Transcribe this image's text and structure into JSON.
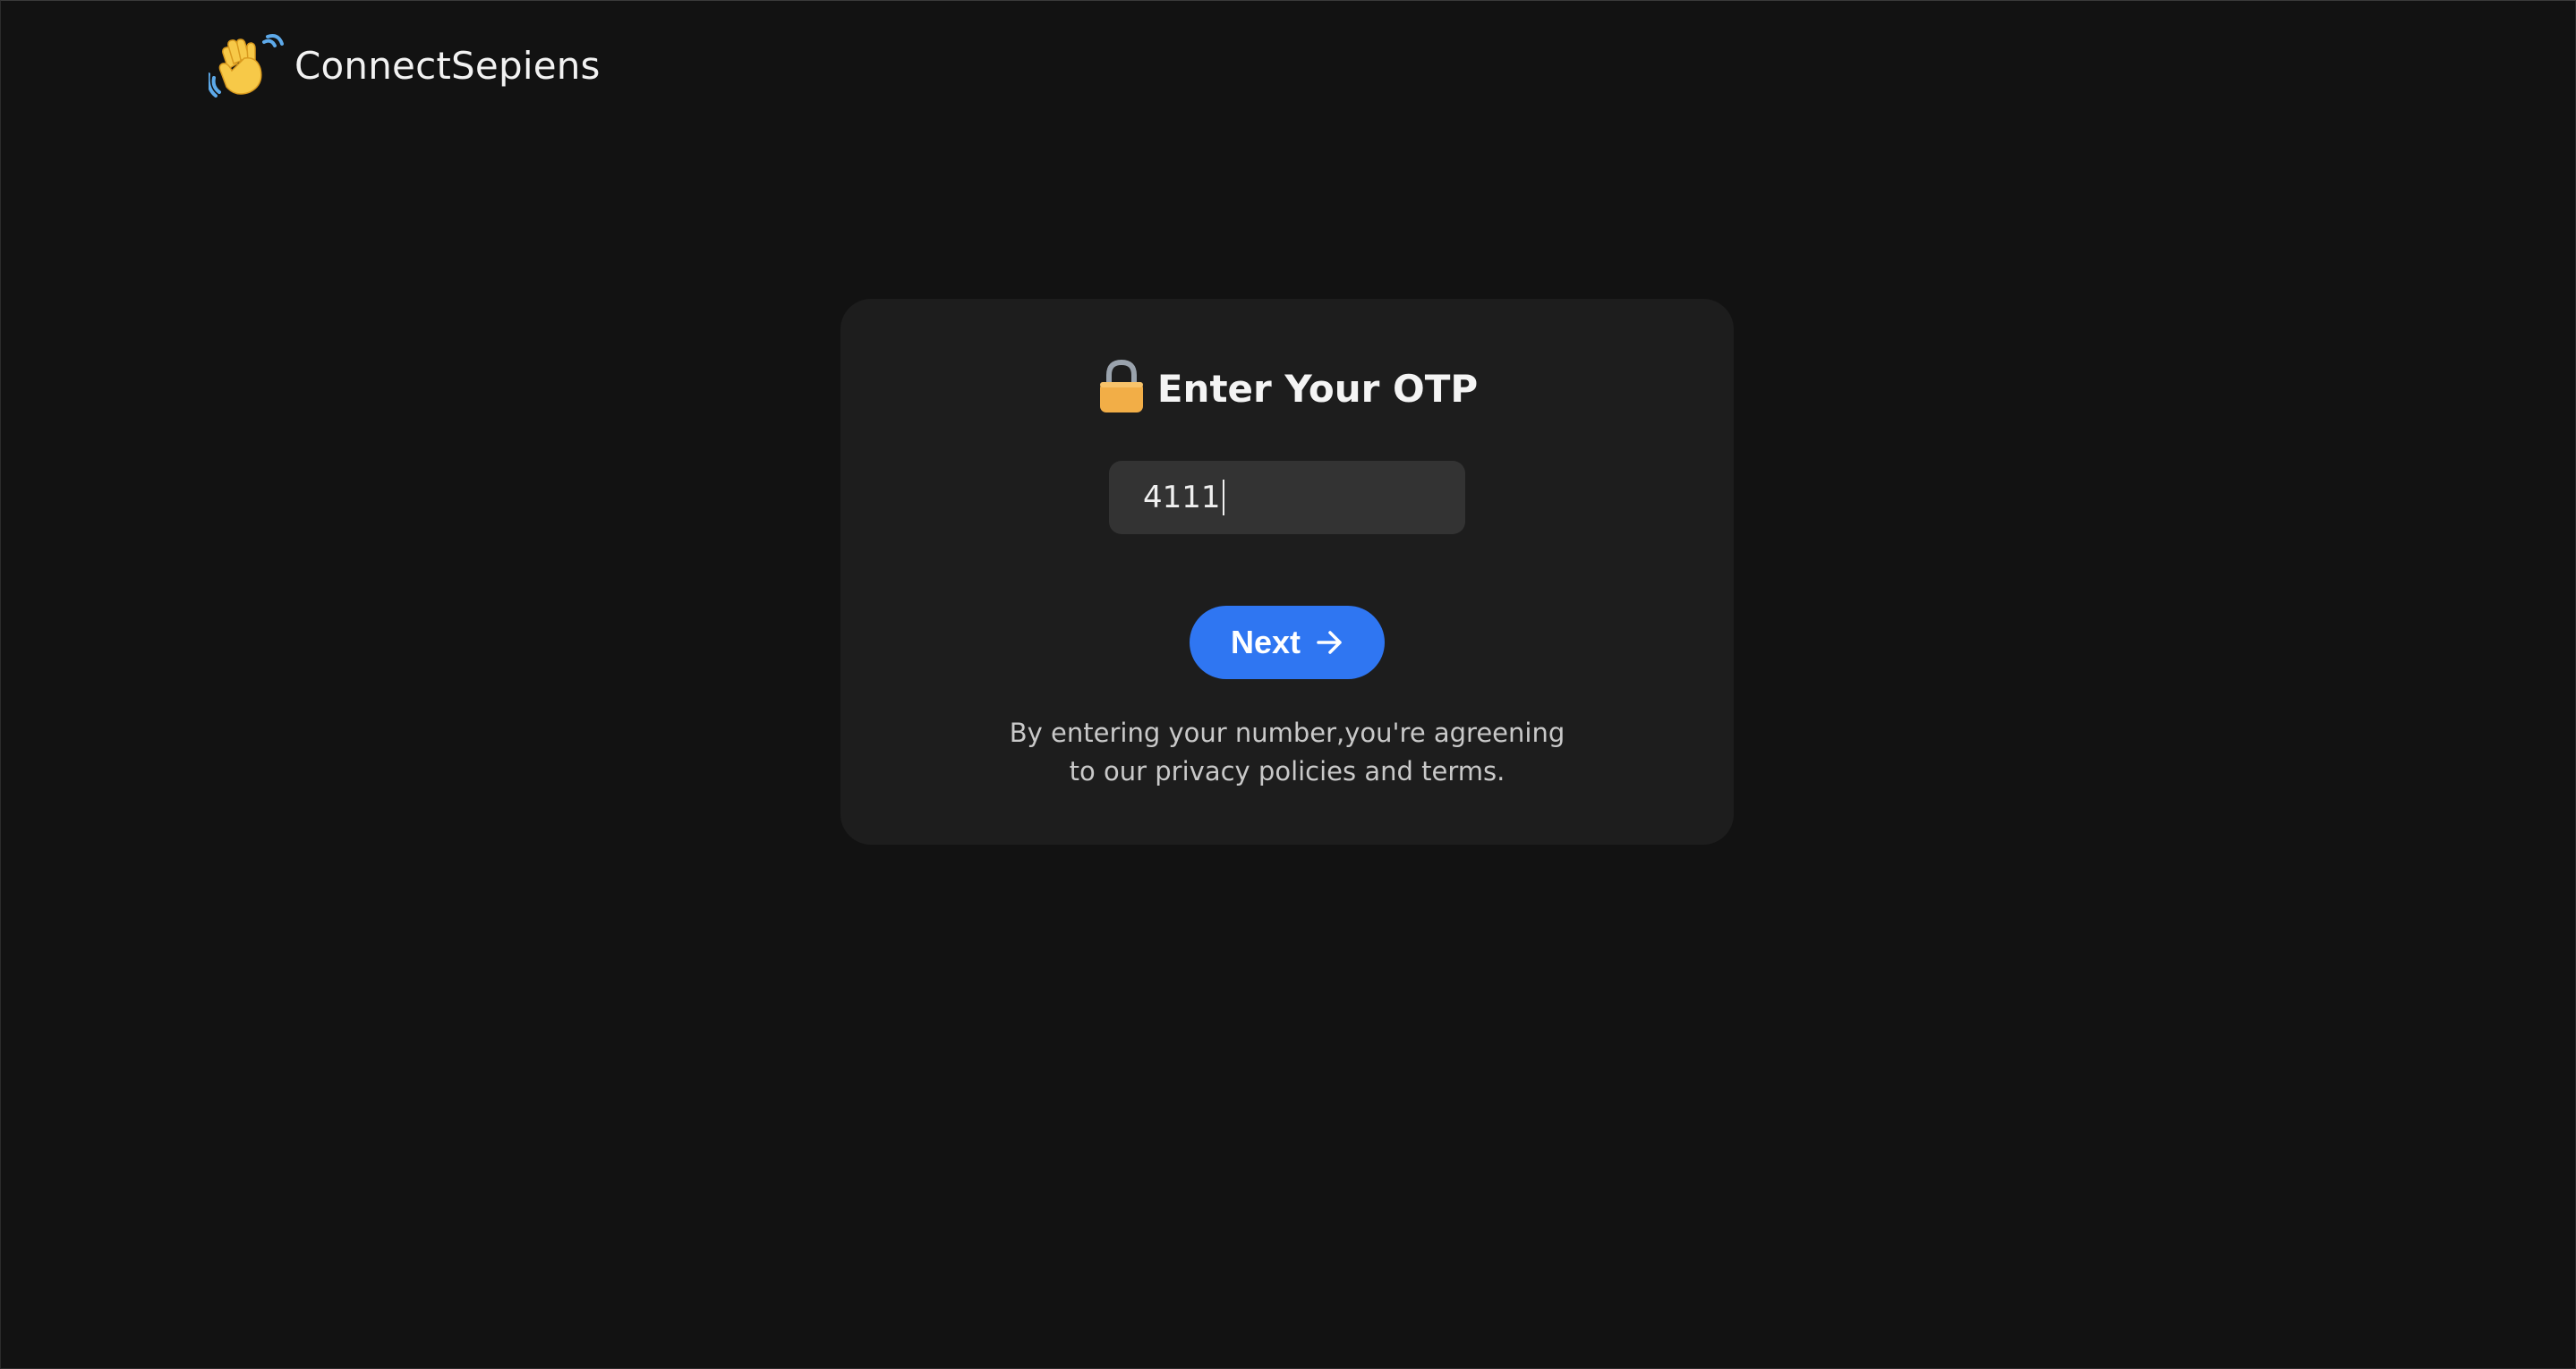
{
  "header": {
    "brand_icon": "waving-hand-icon",
    "brand_name": "ConnectSepiens"
  },
  "otp_card": {
    "title_icon": "lock-icon",
    "title": "Enter Your OTP",
    "input_value": "4111",
    "next_button_label": "Next",
    "next_button_icon": "arrow-right-icon",
    "disclaimer_line1": "By entering your number,you're agreening",
    "disclaimer_line2": "to our privacy policies and terms."
  },
  "colors": {
    "background": "#121212",
    "card": "#1d1d1d",
    "input": "#333333",
    "accent": "#2f76f2",
    "lock_body": "#f2ae47"
  }
}
